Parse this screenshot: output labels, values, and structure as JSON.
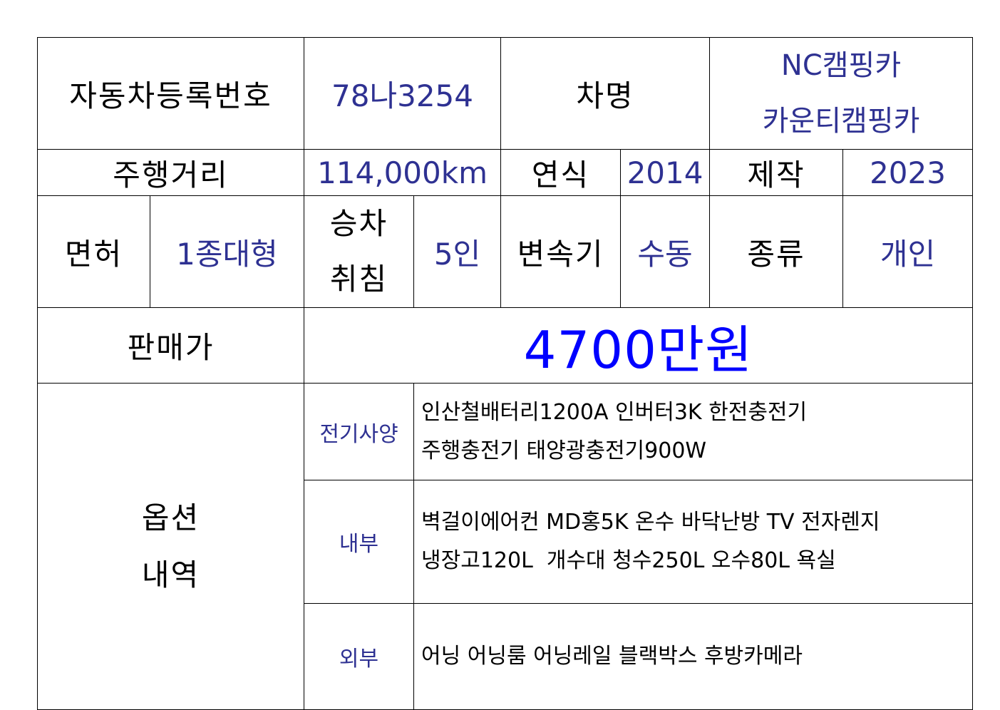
{
  "registration": {
    "label": "자동차등록번호",
    "value": "78나3254"
  },
  "car_name": {
    "label": "차명",
    "line1": "NC캠핑카",
    "line2": "카운티캠핑카"
  },
  "mileage": {
    "label": "주행거리",
    "value": "114,000km"
  },
  "model_year": {
    "label": "연식",
    "value": "2014"
  },
  "manufacture": {
    "label": "제작",
    "value": "2023"
  },
  "license": {
    "label": "면허",
    "value": "1종대형"
  },
  "capacity": {
    "label_line1": "승차",
    "label_line2": "취침",
    "value": "5인"
  },
  "transmission": {
    "label": "변속기",
    "value": "수동"
  },
  "type": {
    "label": "종류",
    "value": "개인"
  },
  "price": {
    "label": "판매가",
    "value": "4700만원"
  },
  "options": {
    "label_line1": "옵션",
    "label_line2": "내역",
    "electrical": {
      "label": "전기사양",
      "line1": "인산철배터리1200A 인버터3K 한전충전기",
      "line2": "주행충전기 태양광충전기900W"
    },
    "interior": {
      "label": "내부",
      "line1": "벽걸이에어컨 MD홍5K 온수 바닥난방 TV 전자렌지",
      "line2": "냉장고120L  개수대 청수250L 오수80L 욕실"
    },
    "exterior": {
      "label": "외부",
      "line1": "어닝 어닝룸 어닝레일 블랙박스 후방카메라"
    }
  },
  "colors": {
    "value_text": "#2e3192",
    "price_text": "#0000ff",
    "label_text": "#000000",
    "border": "#000000"
  }
}
